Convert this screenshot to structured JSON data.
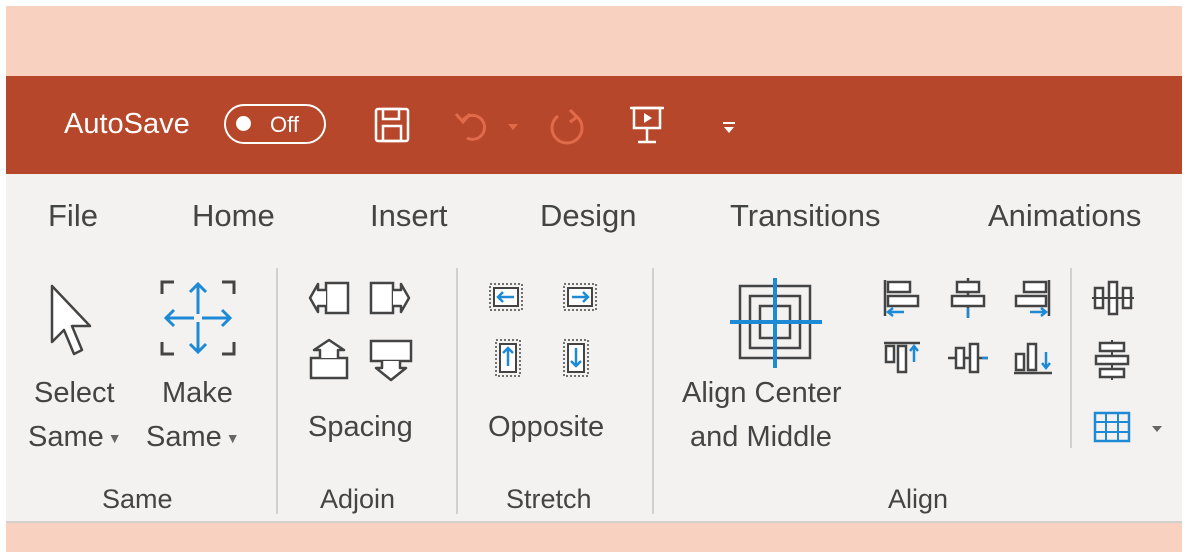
{
  "titlebar": {
    "autosave_label": "AutoSave",
    "autosave_state": "Off",
    "icons": [
      "save-icon",
      "undo-icon",
      "redo-icon",
      "present-from-start-icon",
      "customize-qat-icon"
    ],
    "color": "#b7472a"
  },
  "tabs": [
    "File",
    "Home",
    "Insert",
    "Design",
    "Transitions",
    "Animations"
  ],
  "ribbon": {
    "same": {
      "select_same_line1": "Select",
      "select_same_line2": "Same",
      "make_same_line1": "Make",
      "make_same_line2": "Same",
      "group_label": "Same"
    },
    "adjoin": {
      "spacing_label": "Spacing",
      "group_label": "Adjoin"
    },
    "stretch": {
      "opposite_label": "Opposite",
      "group_label": "Stretch"
    },
    "align": {
      "align_center_line1": "Align Center",
      "align_center_line2": "and Middle",
      "group_label": "Align"
    }
  },
  "colors": {
    "peach": "#f9d1c1",
    "ribbon_bg": "#f3f2f1",
    "icon_blue": "#1e8ad6",
    "icon_gray": "#444444"
  }
}
